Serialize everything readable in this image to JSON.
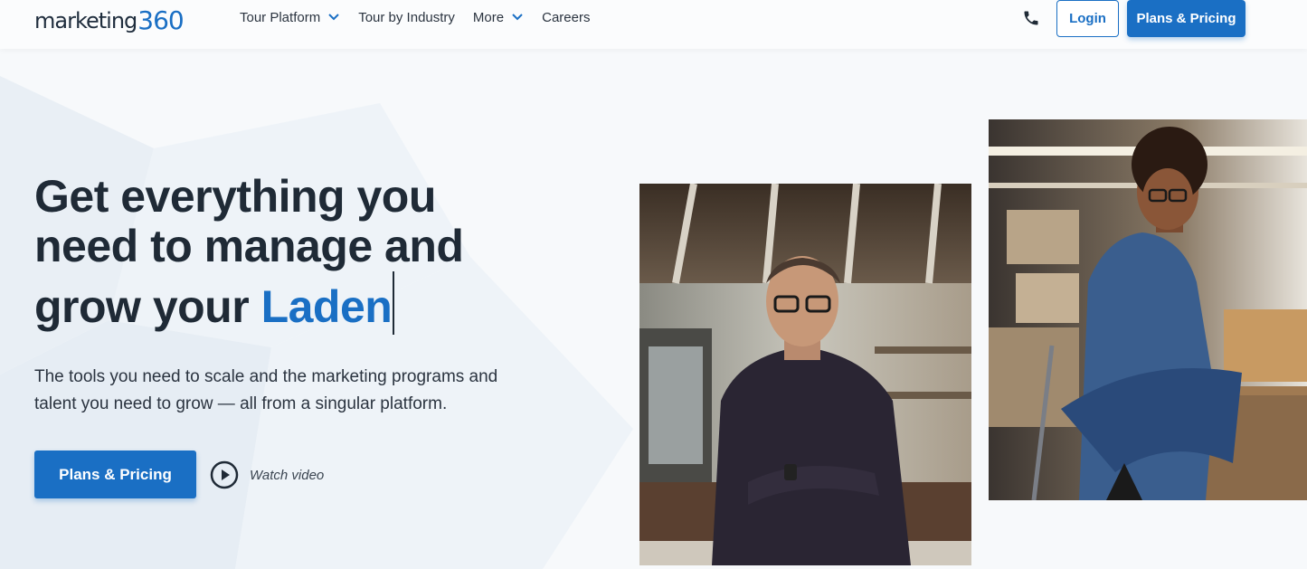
{
  "header": {
    "logo": {
      "word": "marketing",
      "number": "360"
    },
    "nav": [
      {
        "label": "Tour Platform",
        "has_dropdown": true
      },
      {
        "label": "Tour by Industry",
        "has_dropdown": false
      },
      {
        "label": "More",
        "has_dropdown": true
      },
      {
        "label": "Careers",
        "has_dropdown": false
      }
    ],
    "phone_icon": "phone-icon",
    "login_label": "Login",
    "plans_label": "Plans & Pricing"
  },
  "hero": {
    "title_line1": "Get everything you",
    "title_line2": "need to manage and",
    "title_line3_prefix": "grow your ",
    "title_accent": "Laden",
    "subtitle_line1": "The tools you need to scale and the marketing programs and",
    "subtitle_line2": "talent you need to grow — all from a singular platform.",
    "cta_label": "Plans & Pricing",
    "watch_label": "Watch video",
    "play_icon": "play-icon"
  },
  "colors": {
    "brand_blue": "#1a6fc4",
    "text_dark": "#1f2a36",
    "background": "#f7f9fb"
  }
}
